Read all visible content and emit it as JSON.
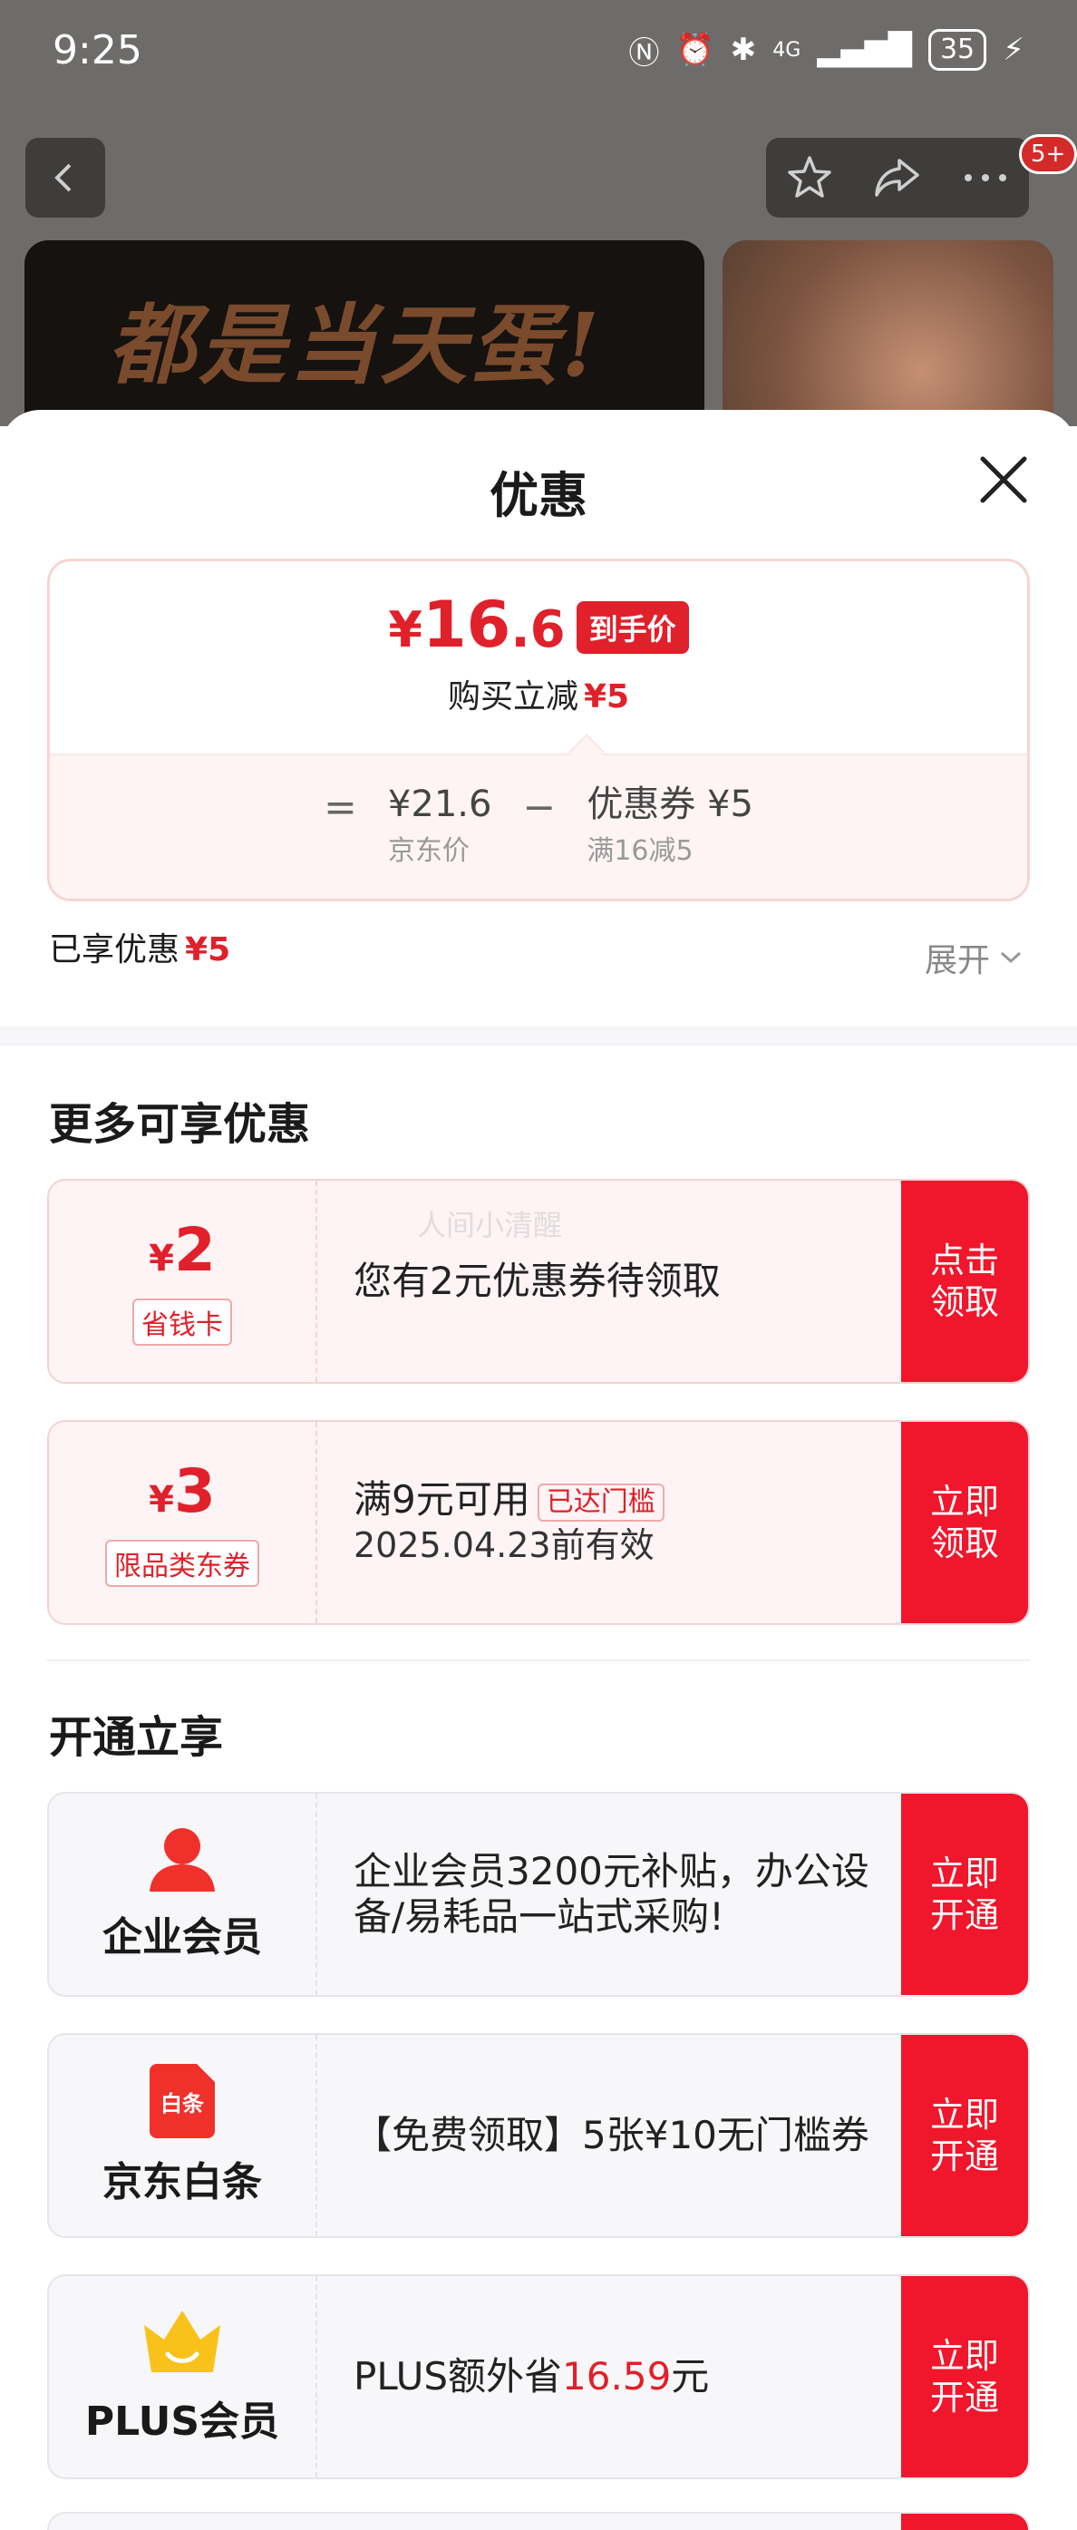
{
  "status_bar": {
    "time": "9:25",
    "network": "4G",
    "battery": "35"
  },
  "background": {
    "banner_slogan": "都是当天蛋!",
    "cart_badge": "5+"
  },
  "sheet": {
    "title": "优惠"
  },
  "price": {
    "currency": "¥",
    "final_int": "16",
    "final_dec": ".6",
    "final_tag": "到手价",
    "instant_label": "购买立减",
    "instant_value": "¥5",
    "equals": "=",
    "minus": "−",
    "jd_price": "¥21.6",
    "jd_price_label": "京东价",
    "coupon_value": "优惠券 ¥5",
    "coupon_rule": "满16减5"
  },
  "enjoyed": {
    "label": "已享优惠",
    "value": "¥5",
    "expand": "展开"
  },
  "more": {
    "title": "更多可享优惠",
    "watermark": "人间小清醒",
    "coupons": [
      {
        "yen": "¥",
        "amount": "2",
        "tag": "省钱卡",
        "line1": "您有2元优惠券待领取",
        "button": "点击领取"
      },
      {
        "yen": "¥",
        "amount": "3",
        "tag": "限品类东券",
        "line1": "满9元可用",
        "badge": "已达门槛",
        "line2": "2025.04.23前有效",
        "button": "立即领取"
      }
    ]
  },
  "open": {
    "title": "开通立享",
    "items": [
      {
        "icon": "person-icon",
        "name": "企业会员",
        "desc": "企业会员3200元补贴，办公设备/易耗品一站式采购!",
        "button": "立即开通"
      },
      {
        "icon": "baitiao-icon",
        "icon_text": "白条",
        "name": "京东白条",
        "desc": "【免费领取】5张¥10无门槛券",
        "button": "立即开通"
      },
      {
        "icon": "crown-icon",
        "name": "PLUS会员",
        "desc_pre": "PLUS额外省",
        "desc_highlight": "16.59",
        "desc_post": "元",
        "button": "立即开通"
      }
    ]
  },
  "colors": {
    "accent": "#e0202a",
    "button": "#f0162b",
    "coupon_bg": "#fff4f5",
    "member_bg": "#f7f7f9"
  }
}
